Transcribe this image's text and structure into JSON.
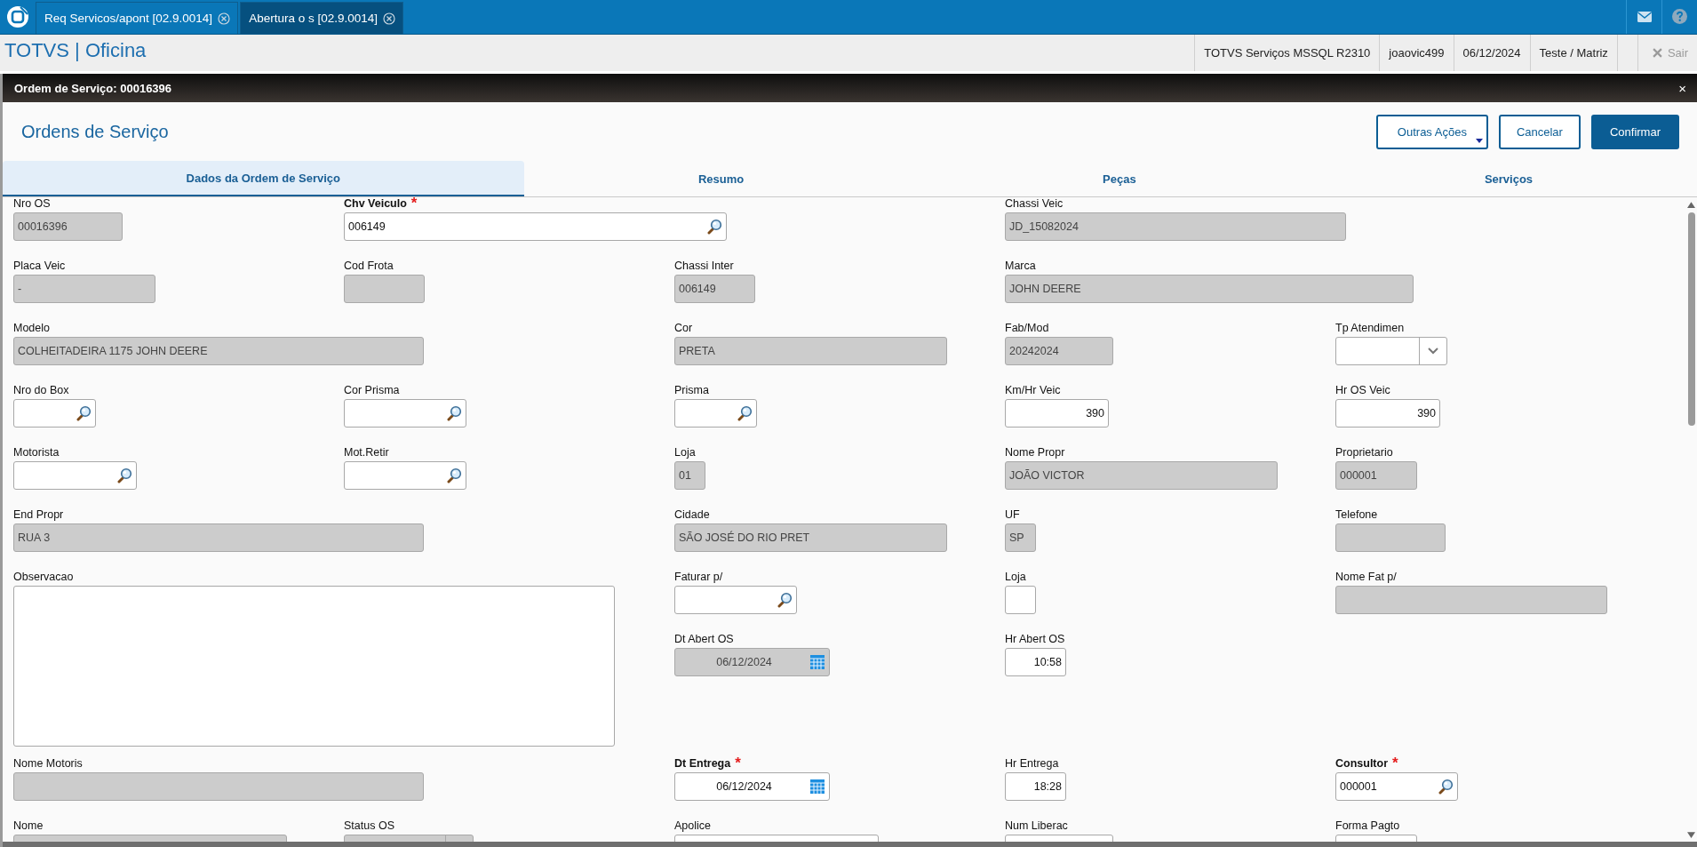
{
  "top_tabs": [
    {
      "label": "Req Servicos/apont [02.9.0014]",
      "selected": false
    },
    {
      "label": "Abertura o s [02.9.0014]",
      "selected": true
    }
  ],
  "app_title": "TOTVS | Oficina",
  "status_items": [
    "TOTVS Serviços MSSQL R2310",
    "joaovic499",
    "06/12/2024",
    "Teste / Matriz"
  ],
  "exit": {
    "label": "Sair",
    "disabled": true
  },
  "dialog": {
    "title": "Ordem de Serviço: 00016396",
    "close": "×"
  },
  "heading": "Ordens de Serviço",
  "buttons": [
    {
      "label": "Outras Ações",
      "kind": "menu"
    },
    {
      "label": "Cancelar",
      "kind": "secondary"
    },
    {
      "label": "Confirmar",
      "kind": "primary"
    }
  ],
  "tabs": [
    {
      "label": "Dados da Ordem de Serviço",
      "selected": true
    },
    {
      "label": "Resumo",
      "selected": false
    },
    {
      "label": "Peças",
      "selected": false
    },
    {
      "label": "Serviços",
      "selected": false
    }
  ],
  "fields": [
    {
      "label": "Nro OS",
      "kind": "text",
      "disabled": true,
      "value": "00016396"
    },
    {
      "label": "Chv Veiculo",
      "kind": "lookup",
      "disabled": false,
      "value": "006149",
      "mark": "*"
    },
    {
      "label": "Chassi Veic",
      "kind": "text",
      "disabled": true,
      "value": "JD_15082024"
    },
    {
      "label": "Placa Veic",
      "kind": "text",
      "disabled": true,
      "value": "-"
    },
    {
      "label": "Cod Frota",
      "kind": "text",
      "disabled": true
    },
    {
      "label": "Chassi Inter",
      "kind": "text",
      "disabled": true,
      "value": "006149"
    },
    {
      "label": "Marca",
      "kind": "text",
      "disabled": true,
      "value": "JOHN DEERE"
    },
    {
      "label": "Modelo",
      "kind": "text",
      "disabled": true,
      "value": "COLHEITADEIRA 1175  JOHN DEERE"
    },
    {
      "label": "Cor",
      "kind": "text",
      "disabled": true,
      "value": "PRETA"
    },
    {
      "label": "Fab/Mod",
      "kind": "text",
      "disabled": true,
      "value": "20242024"
    },
    {
      "label": "Tp Atendimen",
      "kind": "select",
      "disabled": false
    },
    {
      "label": "Nro do Box",
      "kind": "lookup",
      "disabled": false
    },
    {
      "label": "Cor Prisma",
      "kind": "lookup",
      "disabled": false
    },
    {
      "label": "Prisma",
      "kind": "lookup",
      "disabled": false
    },
    {
      "label": "Km/Hr Veic",
      "kind": "number",
      "disabled": false,
      "value": "390"
    },
    {
      "label": "Hr OS Veic",
      "kind": "number",
      "disabled": false,
      "value": "390"
    },
    {
      "label": "Motorista",
      "kind": "lookup",
      "disabled": false
    },
    {
      "label": "Mot.Retir",
      "kind": "lookup",
      "disabled": false
    },
    {
      "label": "Loja",
      "kind": "text",
      "disabled": true,
      "value": "01"
    },
    {
      "label": "Nome Propr",
      "kind": "text",
      "disabled": true,
      "value": "JOÃO VICTOR"
    },
    {
      "label": "Proprietario",
      "kind": "text",
      "disabled": true,
      "value": "000001"
    },
    {
      "label": "End Propr",
      "kind": "text",
      "disabled": true,
      "value": "RUA 3"
    },
    {
      "label": "Cidade",
      "kind": "text",
      "disabled": true,
      "value": "SÃO JOSÉ DO RIO PRET"
    },
    {
      "label": "UF",
      "kind": "text",
      "disabled": true,
      "value": "SP"
    },
    {
      "label": "Telefone",
      "kind": "text",
      "disabled": true
    },
    {
      "label": "Observacao",
      "kind": "textarea",
      "disabled": false
    },
    {
      "label": "Faturar p/",
      "kind": "lookup",
      "disabled": false
    },
    {
      "label": "Loja",
      "kind": "text",
      "disabled": false
    },
    {
      "label": "Nome Fat p/",
      "kind": "text",
      "disabled": true
    },
    {
      "label": "Dt Abert OS",
      "kind": "date",
      "disabled": true,
      "value": "06/12/2024"
    },
    {
      "label": "Hr Abert OS",
      "kind": "number",
      "disabled": false,
      "value": "10:58"
    },
    {
      "label": "Nome Motoris",
      "kind": "text",
      "disabled": true
    },
    {
      "label": "Dt Entrega",
      "kind": "date",
      "disabled": false,
      "value": "06/12/2024",
      "mark": "*"
    },
    {
      "label": "Hr Entrega",
      "kind": "number",
      "disabled": false,
      "value": "18:28"
    },
    {
      "label": "Consultor",
      "kind": "lookup",
      "disabled": false,
      "value": "000001",
      "mark": "*"
    },
    {
      "label": "Nome",
      "kind": "text",
      "disabled": true
    },
    {
      "label": "Status OS",
      "kind": "select",
      "disabled": true
    },
    {
      "label": "Apolice",
      "kind": "text",
      "disabled": false
    },
    {
      "label": "Num Liberac",
      "kind": "number",
      "disabled": false
    },
    {
      "label": "Forma Pagto",
      "kind": "text",
      "disabled": false
    }
  ]
}
